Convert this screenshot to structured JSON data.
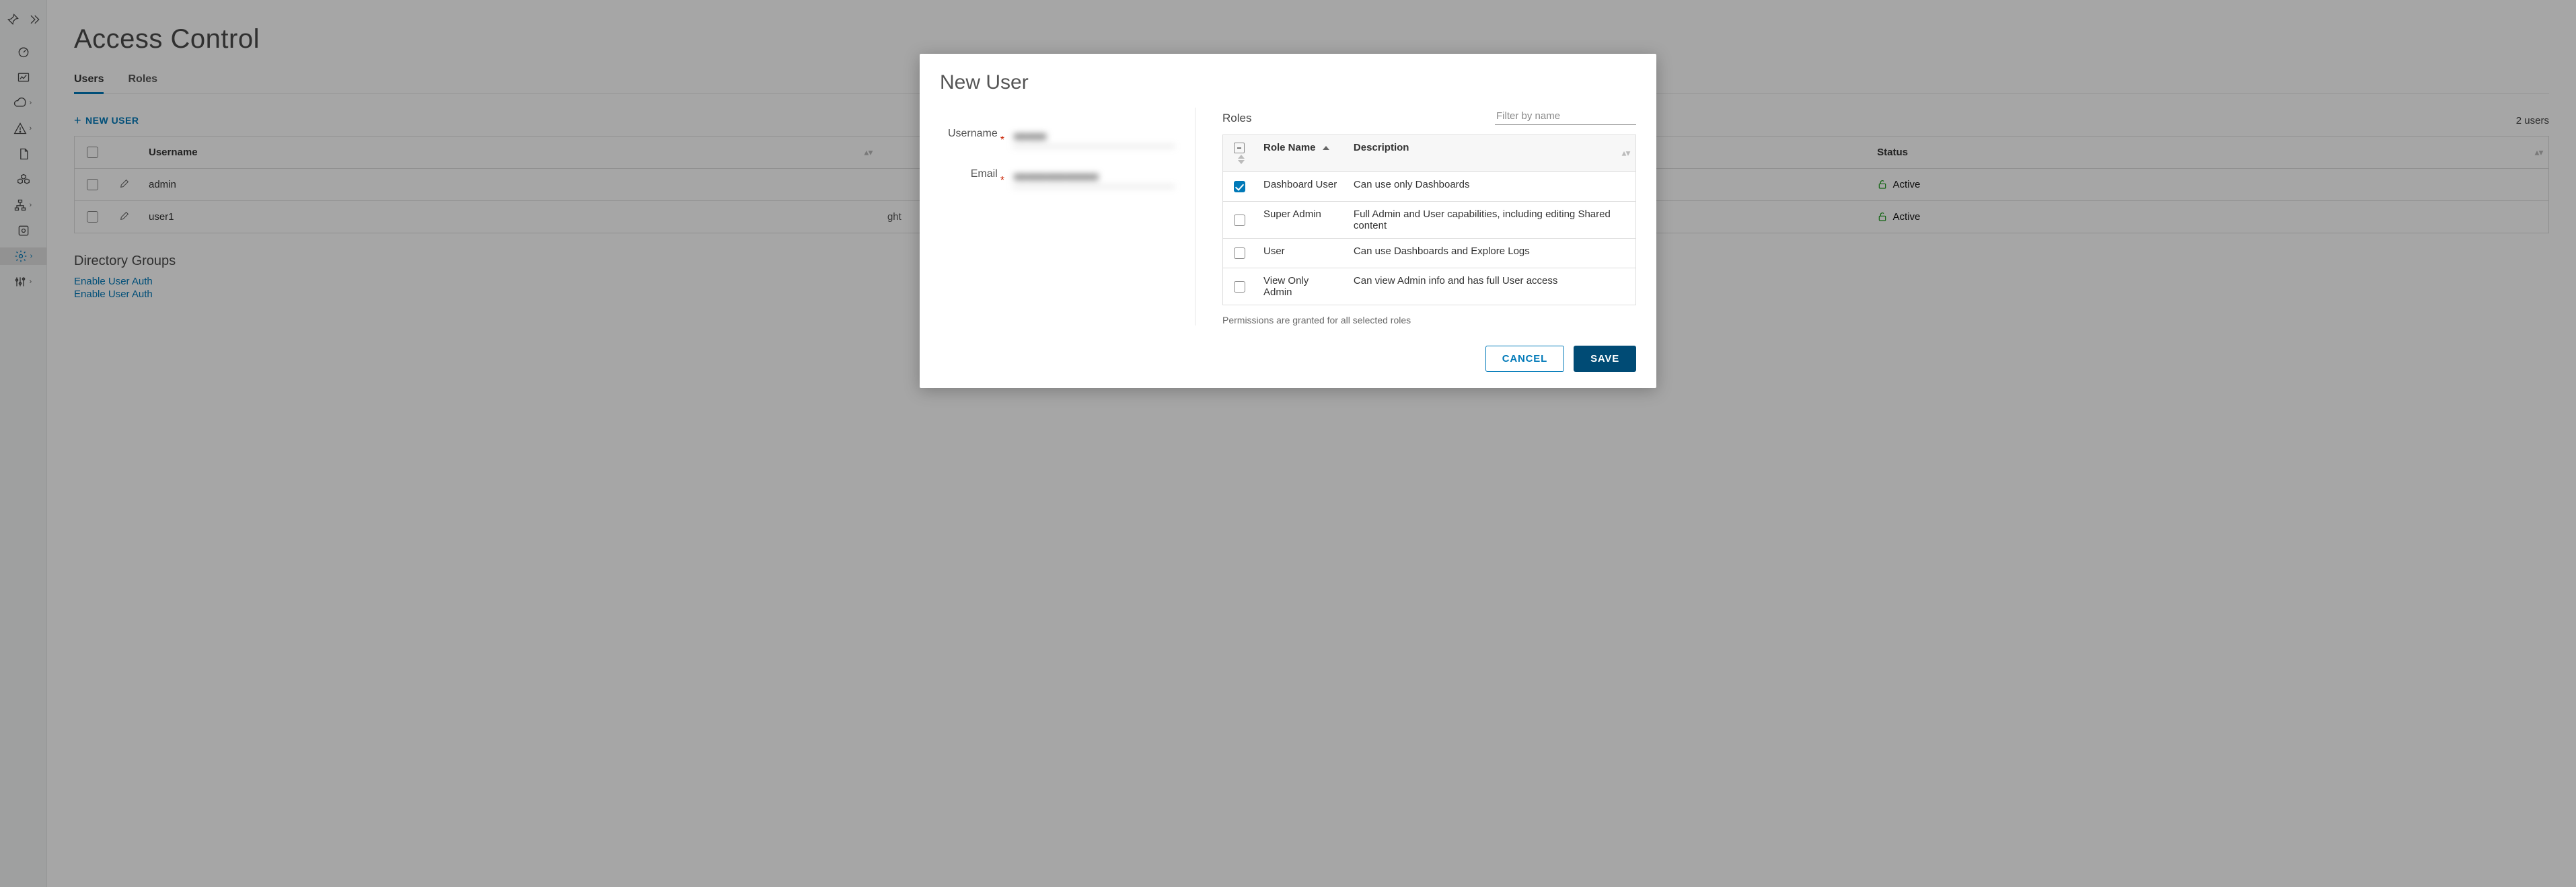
{
  "page": {
    "title": "Access Control",
    "tabs": [
      "Users",
      "Roles"
    ],
    "active_tab": 0,
    "new_user_btn": "NEW USER",
    "user_count": "2 users",
    "table": {
      "headers": [
        "Username",
        "Status"
      ],
      "rows": [
        {
          "username": "admin",
          "roles": "",
          "status": "Active"
        },
        {
          "username": "user1",
          "roles": "ght",
          "status": "Active"
        }
      ]
    },
    "directory_section_title": "Directory Groups",
    "links": [
      "Enable User Auth",
      "Enable User Auth"
    ]
  },
  "modal": {
    "title": "New User",
    "fields": {
      "username_label": "Username",
      "username_value": "■■■■■",
      "email_label": "Email",
      "email_value": "■■■■■■■■■■■■■"
    },
    "roles_label": "Roles",
    "filter_placeholder": "Filter by name",
    "roles_table": {
      "headers": [
        "Role Name",
        "Description"
      ],
      "rows": [
        {
          "checked": true,
          "name": "Dashboard User",
          "desc": "Can use only Dashboards"
        },
        {
          "checked": false,
          "name": "Super Admin",
          "desc": "Full Admin and User capabilities, including editing Shared content"
        },
        {
          "checked": false,
          "name": "User",
          "desc": "Can use Dashboards and Explore Logs"
        },
        {
          "checked": false,
          "name": "View Only Admin",
          "desc": "Can view Admin info and has full User access"
        }
      ]
    },
    "hint": "Permissions are granted for all selected roles",
    "cancel": "CANCEL",
    "save": "SAVE"
  },
  "icons": {
    "pin": "pin-icon",
    "collapse": "chevrons-right-icon"
  }
}
